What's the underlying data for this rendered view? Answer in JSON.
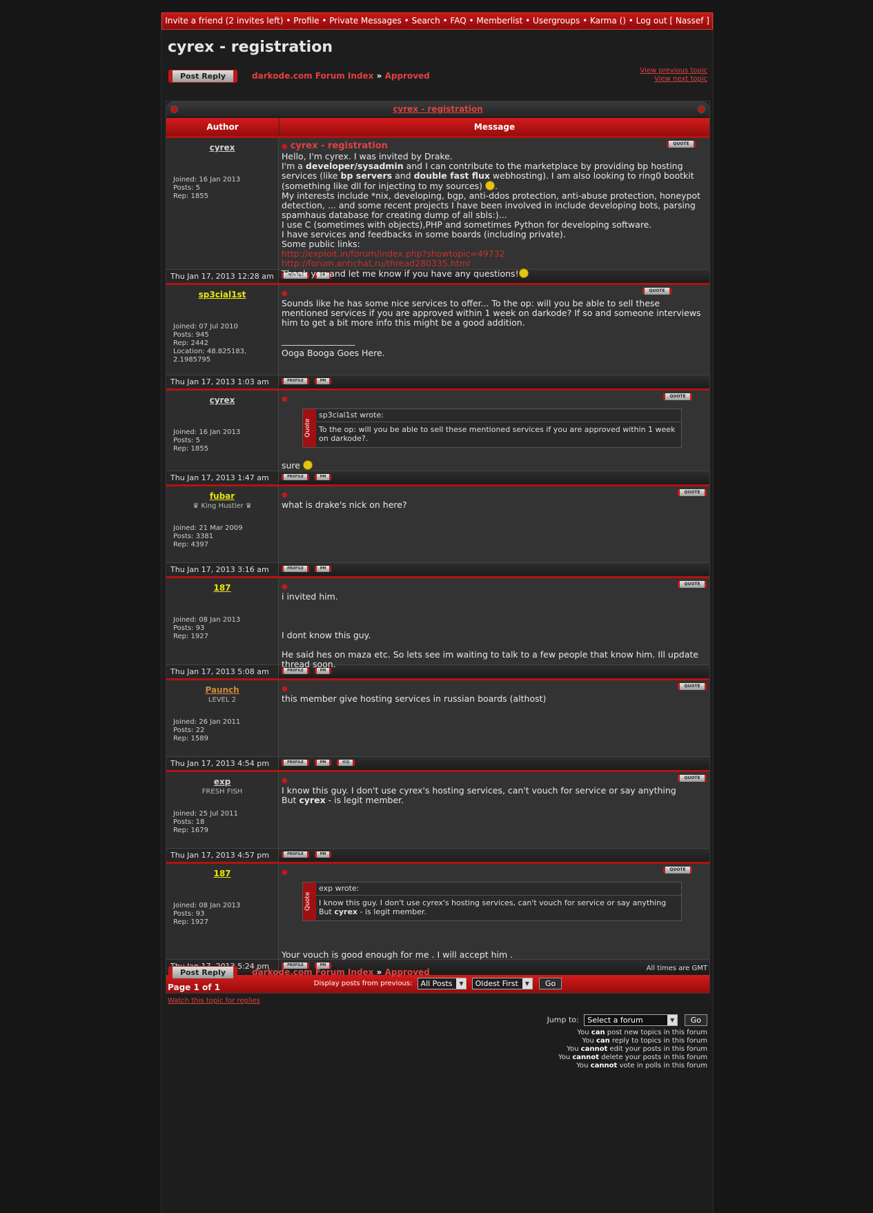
{
  "topnav": "Invite a friend (2 invites left) • Profile • Private Messages • Search • FAQ • Memberlist • Usergroups • Karma () • Log out [ Nassef ]",
  "title": "cyrex - registration",
  "post_reply": "Post Reply",
  "crumb": {
    "index": "darkode.com Forum Index",
    "sep": "»",
    "forum": "Approved"
  },
  "view_prev": "View previous topic",
  "view_next": "View next topic",
  "topic_title": "cyrex - registration",
  "headers": {
    "author": "Author",
    "message": "Message"
  },
  "labels": {
    "quote": "QUOTE",
    "profile": "PROFILE",
    "pm": "PM",
    "icq": "ICQ",
    "wrote_suffix": "wrote:",
    "quote_side": "Quote"
  },
  "posts": [
    {
      "user": "cyrex",
      "user_color": "#d4d4d4",
      "rank": "",
      "joined": "Joined: 16 Jan 2013",
      "posts": "Posts: 5",
      "rep": "Rep: 1855",
      "location": "",
      "date": "Thu Jan 17, 2013 12:28 am",
      "subject": "cyrex - registration",
      "icq": false
    },
    {
      "user": "sp3cial1st",
      "user_color": "#e8e60f",
      "rank": "",
      "joined": "Joined: 07 Jul 2010",
      "posts": "Posts: 945",
      "rep": "Rep: 2442",
      "location": "Location: 48.825183, 2.1985795",
      "date": "Thu Jan 17, 2013 1:03 am",
      "text": "Sounds like he has some nice services to offer... To the op: will you be able to sell these mentioned services if you are approved within 1 week on darkode? If so and someone interviews him to get a bit more info this might be a good addition.",
      "sig_line": "_________________",
      "sig": "Ooga Booga Goes Here.",
      "icq": false
    },
    {
      "user": "cyrex",
      "user_color": "#d4d4d4",
      "rank": "",
      "joined": "Joined: 16 Jan 2013",
      "posts": "Posts: 5",
      "rep": "Rep: 1855",
      "location": "",
      "date": "Thu Jan 17, 2013 1:47 am",
      "quote_author": "sp3cial1st",
      "quote_text": "To the op: will you be able to sell these mentioned services if you are approved within 1 week on darkode?.",
      "text": "sure",
      "icq": false
    },
    {
      "user": "fubar",
      "user_color": "#e8e60f",
      "rank": "♛ King Hustler ♛",
      "joined": "Joined: 21 Mar 2009",
      "posts": "Posts: 3381",
      "rep": "Rep: 4397",
      "location": "",
      "date": "Thu Jan 17, 2013 3:16 am",
      "text": "what is drake's nick on here?",
      "icq": false
    },
    {
      "user": "187",
      "user_color": "#e8e60f",
      "rank": "",
      "joined": "Joined: 08 Jan 2013",
      "posts": "Posts: 93",
      "rep": "Rep: 1927",
      "location": "",
      "date": "Thu Jan 17, 2013 5:08 am",
      "text1": "i invited him.",
      "text2": "I dont know this guy.",
      "text3": "He said hes on maza etc. So lets see im waiting to talk to a few people that know him. Ill update thread soon.",
      "icq": false
    },
    {
      "user": "Paunch",
      "user_color": "#d4883a",
      "rank": "LEVEL 2",
      "joined": "Joined: 26 Jan 2011",
      "posts": "Posts: 22",
      "rep": "Rep: 1589",
      "location": "",
      "date": "Thu Jan 17, 2013 4:54 pm",
      "text": "this member give hosting services in russian boards (althost)",
      "icq": true
    },
    {
      "user": "exp",
      "user_color": "#d4d4d4",
      "rank": "FRESH FISH",
      "joined": "Joined: 25 Jul 2011",
      "posts": "Posts: 18",
      "rep": "Rep: 1679",
      "location": "",
      "date": "Thu Jan 17, 2013 4:57 pm",
      "text1": "I know this guy. I don't use cyrex's hosting services, can't vouch for service or say anything",
      "text2a": "But ",
      "text2b": "cyrex",
      "text2c": " - is legit member.",
      "icq": false
    },
    {
      "user": "187",
      "user_color": "#e8e60f",
      "rank": "",
      "joined": "Joined: 08 Jan 2013",
      "posts": "Posts: 93",
      "rep": "Rep: 1927",
      "location": "",
      "date": "Thu Jan 17, 2013 5:24 pm",
      "quote_author": "exp",
      "quote_line1": "I know this guy. I don't use cyrex's hosting services, can't vouch for service or say anything",
      "quote_line2a": "But ",
      "quote_line2b": "cyrex",
      "quote_line2c": " - is legit member.",
      "text": "Your vouch is good enough for me . I will accept him .",
      "icq": false
    }
  ],
  "post1": {
    "l1": "Hello, I'm cyrex. I was invited by Drake.",
    "l2a": "I'm a ",
    "l2b": "developer/sysadmin",
    "l2c": " and I can contribute to the marketplace by providing bp hosting services (like ",
    "l2d": "bp servers",
    "l2e": " and ",
    "l2f": "double fast flux",
    "l2g": " webhosting). I am also looking to ring0 bootkit (something like dll for injecting to my sources)",
    "l3": "My interests include *nix, developing, bgp, anti-ddos protection, anti-abuse protection, honeypot detection, ... and some recent projects I have been involved in include developing bots, parsing spamhaus database for creating dump of all sbls:)...",
    "l4": "I use C (sometimes with objects),PHP and sometimes Python for developing software.",
    "l5": "I have services and feedbacks in some boards (including private).",
    "l6": "Some public links:",
    "link1": "http://exploit.in/forum/index.php?showtopic=49732",
    "link2": "http://forum.antichat.ru/thread280335.html",
    "l7": "Thank you and let me know if you have any questions!"
  },
  "display": {
    "label": "Display posts from previous:",
    "posts": "All Posts",
    "order": "Oldest First",
    "go": "Go"
  },
  "times": "All times are GMT",
  "page": "Page 1 of 1",
  "watch": "Watch this topic for replies",
  "jump": {
    "label": "Jump to:",
    "select": "Select a forum",
    "go": "Go"
  },
  "perms": [
    {
      "a": "You ",
      "b": "can",
      "c": " post new topics in this forum"
    },
    {
      "a": "You ",
      "b": "can",
      "c": " reply to topics in this forum"
    },
    {
      "a": "You ",
      "b": "cannot",
      "c": " edit your posts in this forum"
    },
    {
      "a": "You ",
      "b": "cannot",
      "c": " delete your posts in this forum"
    },
    {
      "a": "You ",
      "b": "cannot",
      "c": " vote in polls in this forum"
    }
  ]
}
